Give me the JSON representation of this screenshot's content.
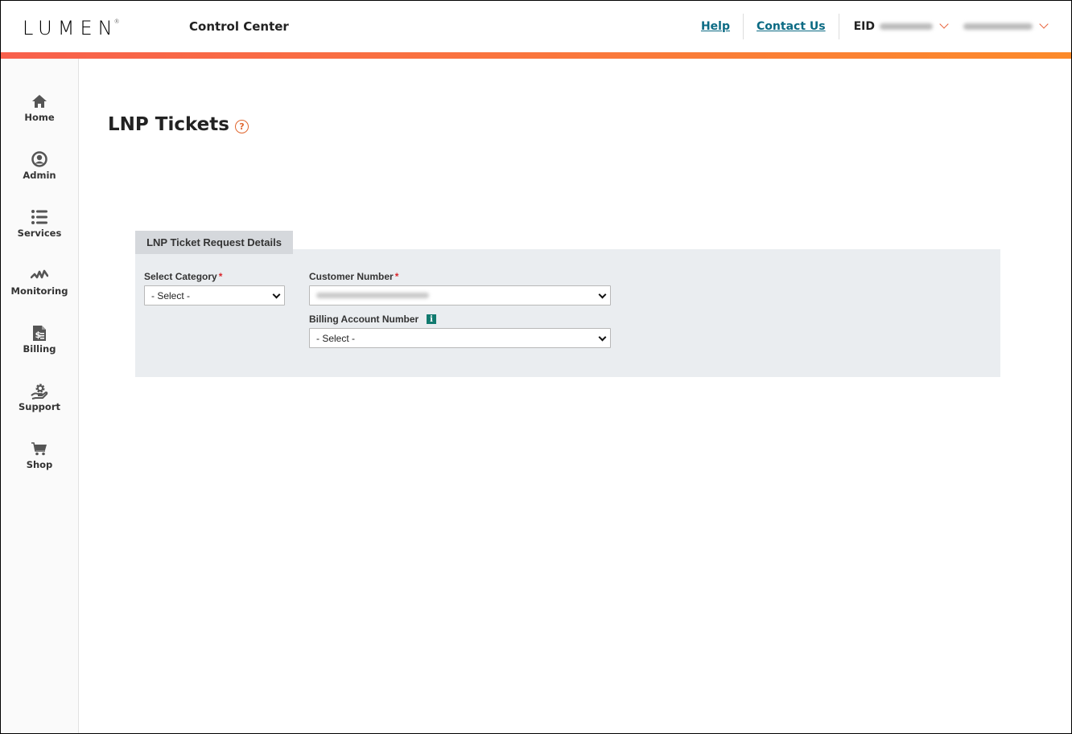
{
  "header": {
    "logo_text": "LUMEN",
    "logo_mark": "®",
    "app_title": "Control Center",
    "links": [
      {
        "label": "Help"
      },
      {
        "label": "Contact Us"
      }
    ],
    "eid_label": "EID",
    "eid_value_redacted": true,
    "user_redacted": true
  },
  "sidebar": {
    "items": [
      {
        "label": "Home",
        "icon": "home-icon"
      },
      {
        "label": "Admin",
        "icon": "user-circle-icon"
      },
      {
        "label": "Services",
        "icon": "list-icon"
      },
      {
        "label": "Monitoring",
        "icon": "pulse-icon"
      },
      {
        "label": "Billing",
        "icon": "invoice-icon"
      },
      {
        "label": "Support",
        "icon": "support-gear-hand-icon"
      },
      {
        "label": "Shop",
        "icon": "cart-icon"
      }
    ]
  },
  "main": {
    "page_title": "LNP Tickets",
    "help_icon": "?",
    "panel": {
      "tab_label": "LNP Ticket Request Details",
      "fields": {
        "category": {
          "label": "Select Category",
          "required_mark": "*",
          "value": "- Select -"
        },
        "customer_number": {
          "label": "Customer Number",
          "required_mark": "*",
          "value_redacted": true
        },
        "billing_account": {
          "label": "Billing Account Number",
          "info_icon": "i",
          "value": "- Select -"
        }
      }
    }
  },
  "colors": {
    "accent_orange": "#e0662e",
    "link_teal": "#0c6b84",
    "info_green": "#117a6f",
    "required_red": "#d9262c",
    "gradient_start": "#f8604c",
    "gradient_end": "#fc8a2a"
  }
}
